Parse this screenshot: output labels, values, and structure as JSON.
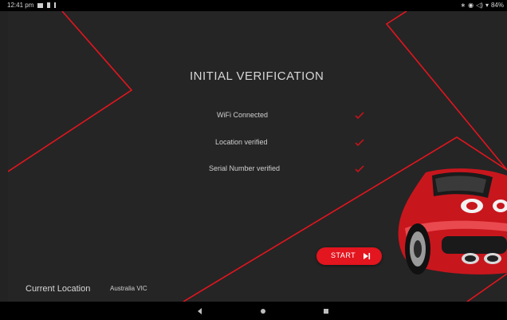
{
  "status_bar": {
    "time": "12:41 pm",
    "battery": "84%"
  },
  "main": {
    "title": "INITIAL VERIFICATION",
    "checks": [
      {
        "label": "WiFi Connected",
        "status": "verified"
      },
      {
        "label": "Location verified",
        "status": "verified"
      },
      {
        "label": "Serial Number verified",
        "status": "verified"
      }
    ],
    "start_button": {
      "label": "START",
      "icon": "skip-next-icon"
    }
  },
  "footer": {
    "location_label": "Current Location",
    "location_value": "Australia VIC"
  },
  "nav_bar": {
    "buttons": [
      "back-icon",
      "home-icon",
      "recents-icon"
    ]
  },
  "colors": {
    "accent": "#e3151e",
    "background": "#252525",
    "text": "#d6d6d6"
  }
}
